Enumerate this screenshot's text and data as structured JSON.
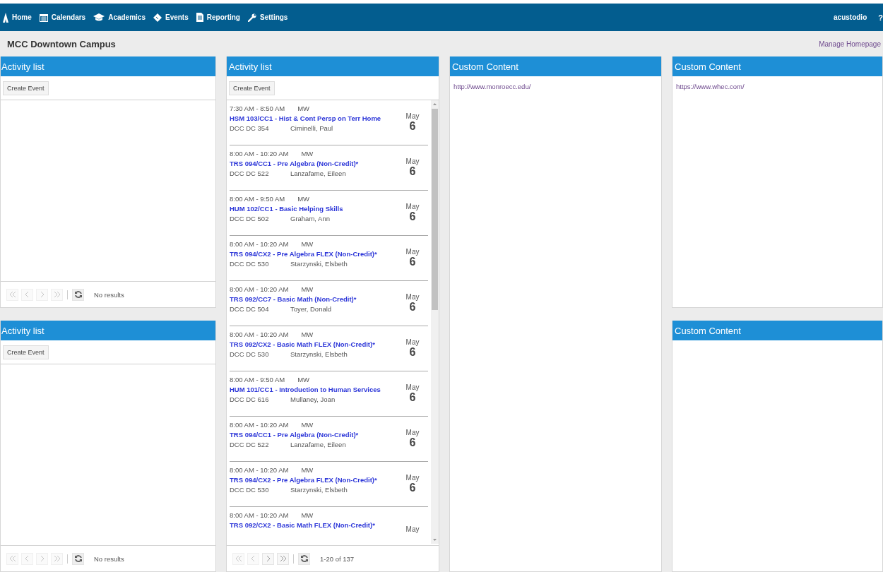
{
  "nav": {
    "items": [
      {
        "label": "Home"
      },
      {
        "label": "Calendars"
      },
      {
        "label": "Academics"
      },
      {
        "label": "Events"
      },
      {
        "label": "Reporting"
      },
      {
        "label": "Settings"
      }
    ],
    "user": "acustodio",
    "help": "?"
  },
  "page_title": "MCC Downtown Campus",
  "manage_link": "Manage Homepage",
  "columns": [
    {
      "panels": [
        {
          "kind": "activity",
          "title": "Activity list",
          "button": "Create Event",
          "pager": {
            "first_disabled": true,
            "prev_disabled": true,
            "next_disabled": true,
            "last_disabled": true,
            "status": "No results"
          }
        },
        {
          "kind": "activity",
          "title": "Activity list",
          "button": "Create Event",
          "pager": {
            "first_disabled": true,
            "prev_disabled": true,
            "next_disabled": true,
            "last_disabled": true,
            "status": "No results"
          }
        }
      ]
    },
    {
      "panels": [
        {
          "kind": "activity",
          "title": "Activity list",
          "button": "Create Event",
          "items": [
            {
              "time": "7:30 AM - 8:50 AM",
              "days": "MW",
              "title": "HSM 103/CC1 - Hist & Cont Persp on Terr Home",
              "room": "DCC DC 354",
              "instructor": "Ciminelli, Paul",
              "month": "May",
              "day": "6"
            },
            {
              "time": "8:00 AM - 10:20 AM",
              "days": "MW",
              "title": "TRS 094/CC1 - Pre Algebra (Non-Credit)*",
              "room": "DCC DC 522",
              "instructor": "Lanzafame, Eileen",
              "month": "May",
              "day": "6"
            },
            {
              "time": "8:00 AM - 9:50 AM",
              "days": "MW",
              "title": "HUM 102/CC1 - Basic Helping Skills",
              "room": "DCC DC 502",
              "instructor": "Graham, Ann",
              "month": "May",
              "day": "6"
            },
            {
              "time": "8:00 AM - 10:20 AM",
              "days": "MW",
              "title": "TRS 094/CX2 - Pre Algebra FLEX (Non-Credit)*",
              "room": "DCC DC 530",
              "instructor": "Starzynski, Elsbeth",
              "month": "May",
              "day": "6"
            },
            {
              "time": "8:00 AM - 10:20 AM",
              "days": "MW",
              "title": "TRS 092/CC7 - Basic Math (Non-Credit)*",
              "room": "DCC DC 504",
              "instructor": "Toyer, Donald",
              "month": "May",
              "day": "6"
            },
            {
              "time": "8:00 AM - 10:20 AM",
              "days": "MW",
              "title": "TRS 092/CX2 - Basic Math FLEX (Non-Credit)*",
              "room": "DCC DC 530",
              "instructor": "Starzynski, Elsbeth",
              "month": "May",
              "day": "6"
            },
            {
              "time": "8:00 AM - 9:50 AM",
              "days": "MW",
              "title": "HUM 101/CC1 - Introduction to Human Services",
              "room": "DCC DC 616",
              "instructor": "Mullaney, Joan",
              "month": "May",
              "day": "6"
            },
            {
              "time": "8:00 AM - 10:20 AM",
              "days": "MW",
              "title": "TRS 094/CC1 - Pre Algebra (Non-Credit)*",
              "room": "DCC DC 522",
              "instructor": "Lanzafame, Eileen",
              "month": "May",
              "day": "6"
            },
            {
              "time": "8:00 AM - 10:20 AM",
              "days": "MW",
              "title": "TRS 094/CX2 - Pre Algebra FLEX (Non-Credit)*",
              "room": "DCC DC 530",
              "instructor": "Starzynski, Elsbeth",
              "month": "May",
              "day": "6"
            },
            {
              "time": "8:00 AM - 10:20 AM",
              "days": "MW",
              "title": "TRS 092/CX2 - Basic Math FLEX (Non-Credit)*",
              "month": "May"
            }
          ],
          "pager": {
            "first_disabled": true,
            "prev_disabled": true,
            "next_disabled": false,
            "last_disabled": false,
            "status": "1-20 of 137"
          }
        }
      ]
    },
    {
      "panels": [
        {
          "kind": "custom",
          "title": "Custom Content",
          "link": "http://www.monroecc.edu/"
        }
      ]
    },
    {
      "panels": [
        {
          "kind": "custom",
          "title": "Custom Content",
          "link": "https://www.whec.com/"
        },
        {
          "kind": "custom",
          "title": "Custom Content"
        }
      ]
    }
  ]
}
